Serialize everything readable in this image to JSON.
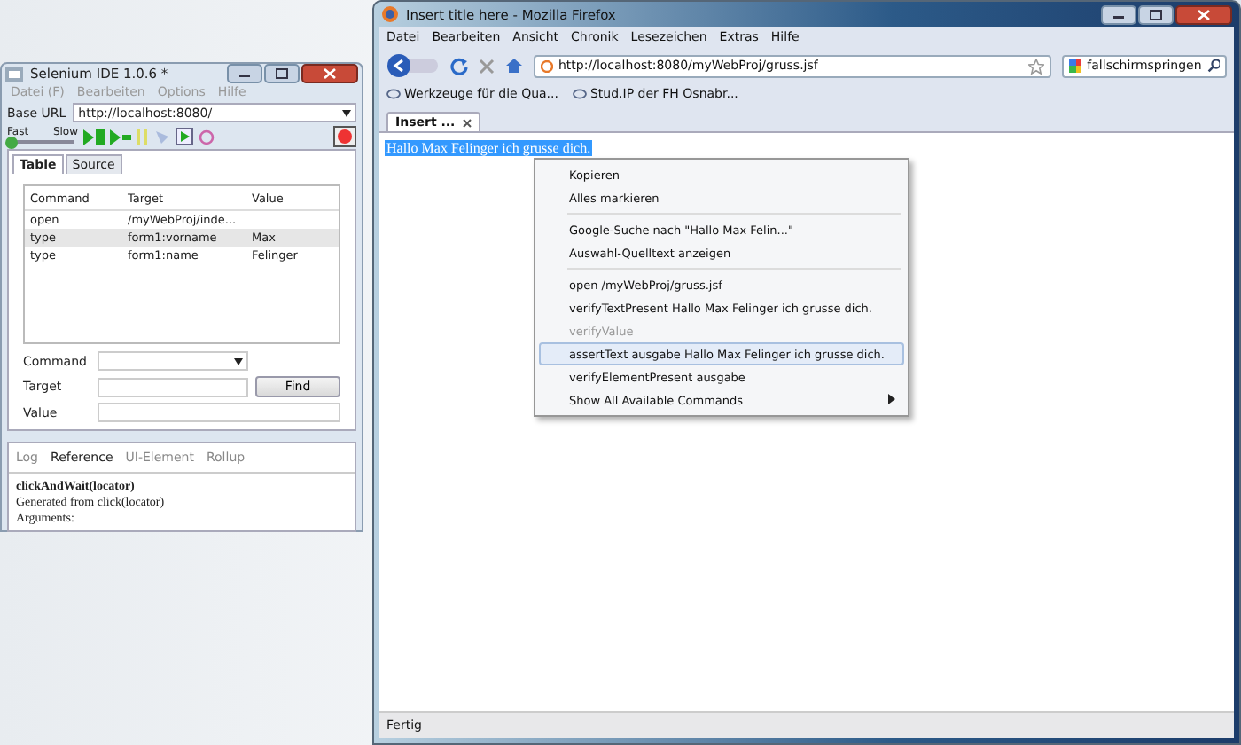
{
  "selenium_ide": {
    "title": "Selenium IDE 1.0.6 *",
    "menu": [
      "Datei (F)",
      "Bearbeiten",
      "Options",
      "Hilfe"
    ],
    "base_url": {
      "label": "Base URL",
      "value": "http://localhost:8080/"
    },
    "speed": {
      "fast_label": "Fast",
      "slow_label": "Slow",
      "level": 0
    },
    "tabs": [
      {
        "label": "Table",
        "selected": true
      },
      {
        "label": "Source",
        "selected": false
      }
    ],
    "table": {
      "columns": [
        "Command",
        "Target",
        "Value"
      ],
      "rows": [
        {
          "cells": [
            "open",
            "/myWebProj/inde...",
            ""
          ],
          "selected": false
        },
        {
          "cells": [
            "type",
            "form1:vorname",
            "Max"
          ],
          "selected": true
        },
        {
          "cells": [
            "type",
            "form1:name",
            "Felinger"
          ],
          "selected": false
        }
      ]
    },
    "form": {
      "command_label": "Command",
      "target_label": "Target",
      "value_label": "Value",
      "find_button": "Find"
    },
    "bottom_tabs": [
      {
        "label": "Log",
        "selected": false
      },
      {
        "label": "Reference",
        "selected": true
      },
      {
        "label": "UI-Element",
        "selected": false
      },
      {
        "label": "Rollup",
        "selected": false
      }
    ],
    "reference": {
      "heading": "clickAndWait(locator)",
      "lines": [
        "Generated from click(locator)",
        "Arguments:"
      ]
    }
  },
  "firefox": {
    "title": "Insert title here - Mozilla Firefox",
    "menu": [
      "Datei",
      "Bearbeiten",
      "Ansicht",
      "Chronik",
      "Lesezeichen",
      "Extras",
      "Hilfe"
    ],
    "url": "http://localhost:8080/myWebProj/gruss.jsf",
    "search": "fallschirmspringen",
    "bookmarks": [
      "Werkzeuge für die Qua...",
      "Stud.IP der FH Osnabr..."
    ],
    "tabs": [
      {
        "label": "Insert ...",
        "selected": true
      }
    ],
    "page_text": "Hallo Max Felinger ich grusse dich.",
    "context_menu": [
      {
        "kind": "item",
        "label": "Kopieren",
        "disabled": false,
        "selected": false,
        "has_submenu": false
      },
      {
        "kind": "item",
        "label": "Alles markieren",
        "disabled": false,
        "selected": false,
        "has_submenu": false
      },
      {
        "kind": "separator"
      },
      {
        "kind": "item",
        "label": "Google-Suche nach \"Hallo Max Felin...\"",
        "disabled": false,
        "selected": false,
        "has_submenu": false
      },
      {
        "kind": "item",
        "label": "Auswahl-Quelltext anzeigen",
        "disabled": false,
        "selected": false,
        "has_submenu": false
      },
      {
        "kind": "separator"
      },
      {
        "kind": "item",
        "label": "open /myWebProj/gruss.jsf",
        "disabled": false,
        "selected": false,
        "has_submenu": false
      },
      {
        "kind": "item",
        "label": "verifyTextPresent Hallo Max Felinger ich grusse dich.",
        "disabled": false,
        "selected": false,
        "has_submenu": false
      },
      {
        "kind": "item",
        "label": "verifyValue",
        "disabled": true,
        "selected": false,
        "has_submenu": false
      },
      {
        "kind": "item",
        "label": "assertText ausgabe Hallo Max Felinger ich grusse dich.",
        "disabled": false,
        "selected": true,
        "has_submenu": false
      },
      {
        "kind": "item",
        "label": "verifyElementPresent ausgabe",
        "disabled": false,
        "selected": false,
        "has_submenu": false
      },
      {
        "kind": "item",
        "label": "Show All Available Commands",
        "disabled": false,
        "selected": false,
        "has_submenu": true
      }
    ],
    "status": "Fertig"
  }
}
